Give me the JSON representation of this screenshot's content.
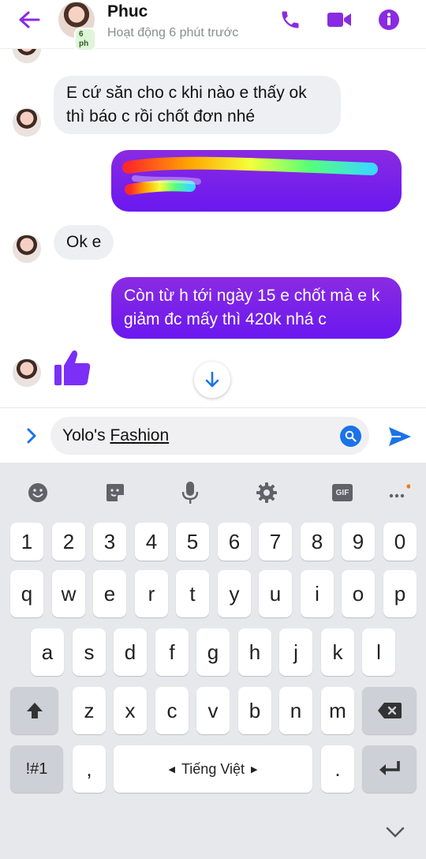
{
  "header": {
    "contact_name": "Phuc",
    "status": "Hoạt động 6 phút trước",
    "avatar_badge": "6 ph",
    "icons": [
      "back-arrow-icon",
      "phone-icon",
      "video-camera-icon",
      "info-icon"
    ],
    "accent_color": "#8a2be2"
  },
  "messages": [
    {
      "side": "in",
      "text": "E cứ săn cho c khi nào e thấy ok thì báo c rồi chốt đơn nhé"
    },
    {
      "side": "out",
      "text": "redacted (scribbled over)"
    },
    {
      "side": "in",
      "text": "Ok e"
    },
    {
      "side": "out",
      "text": "Còn từ h tới ngày 15 e chốt mà e k giảm đc mấy thì 420k nhá c"
    },
    {
      "side": "in",
      "text": "thumbs-up"
    }
  ],
  "composer": {
    "text_plain": "Yolo's ",
    "text_underlined": "Fashion"
  },
  "keyboard": {
    "toolbar": [
      "emoji-icon",
      "sticker-icon",
      "mic-icon",
      "settings-icon",
      "GIF",
      "more-icon"
    ],
    "row_numbers": [
      "1",
      "2",
      "3",
      "4",
      "5",
      "6",
      "7",
      "8",
      "9",
      "0"
    ],
    "row1": [
      "q",
      "w",
      "e",
      "r",
      "t",
      "y",
      "u",
      "i",
      "o",
      "p"
    ],
    "row2": [
      "a",
      "s",
      "d",
      "f",
      "g",
      "h",
      "j",
      "k",
      "l"
    ],
    "row3": [
      "z",
      "x",
      "c",
      "v",
      "b",
      "n",
      "m"
    ],
    "symbols_key": "!#1",
    "comma_key": ",",
    "space_label": "Tiếng Việt",
    "period_key": "."
  }
}
